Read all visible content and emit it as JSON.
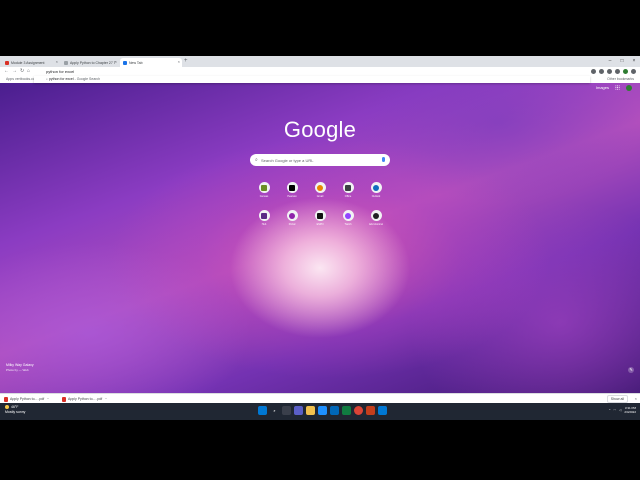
{
  "browser": {
    "tabs": [
      {
        "title": "Module 3 Assignment",
        "favicon_color": "#d93025",
        "active": false
      },
      {
        "title": "Apply Python to Chapter 27 T",
        "favicon_color": "#9aa0a6",
        "active": false
      },
      {
        "title": "New Tab",
        "favicon_color": "#1a73e8",
        "active": true
      }
    ],
    "omnibox_value": "python for excel",
    "suggestion_query": "python for excel",
    "suggestion_hint": "- Google Search",
    "bookmarks_left": "Apps  vertbooks.com",
    "bookmarks_right": "Other bookmarks"
  },
  "ntp": {
    "top_link": "Images",
    "logo": "Google",
    "search_placeholder": "Search Google or type a URL",
    "shortcuts": [
      {
        "label": "Canvas",
        "color": "#6b8e23",
        "icon": "shortcut-icon"
      },
      {
        "label": "Pearson",
        "color": "#000000",
        "icon": "shortcut-icon"
      },
      {
        "label": "Gmail",
        "color": "#ea8600",
        "icon": "shortcut-icon"
      },
      {
        "label": "Office",
        "color": "#3c4043",
        "icon": "shortcut-icon"
      },
      {
        "label": "Outlook",
        "color": "#0f6cbd",
        "icon": "shortcut-icon"
      },
      {
        "label": "Hub",
        "color": "#5b2a86",
        "icon": "shortcut-icon"
      },
      {
        "label": "Portal",
        "color": "#8e24aa",
        "icon": "shortcut-icon"
      },
      {
        "label": "ESPN",
        "color": "#111111",
        "icon": "shortcut-icon"
      },
      {
        "label": "Twitch",
        "color": "#9146ff",
        "icon": "shortcut-icon"
      },
      {
        "label": "Add shortcut",
        "color": "#202124",
        "icon": "add-icon"
      }
    ],
    "credit_line1": "Milky Way Galaxy",
    "credit_line2": "Photo by — Web"
  },
  "downloads": {
    "items": [
      {
        "name": "Apply Python to... .pdf"
      },
      {
        "name": "Apply Python to... .pdf"
      }
    ],
    "show_all": "Show all"
  },
  "taskbar": {
    "weather_temp": "46°F",
    "weather_desc": "Mostly sunny",
    "time": "3:31 PM",
    "date": "2/4/2022"
  }
}
